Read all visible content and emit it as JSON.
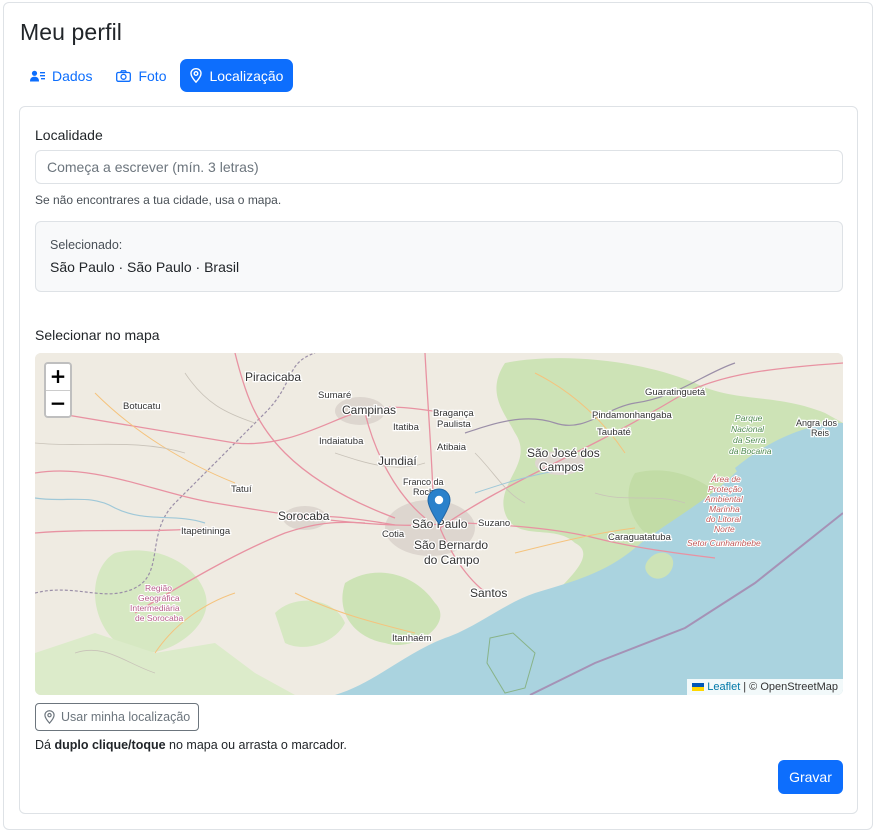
{
  "page": {
    "title": "Meu perfil"
  },
  "tabs": [
    {
      "label": "Dados",
      "icon": "user-list-icon",
      "active": false
    },
    {
      "label": "Foto",
      "icon": "camera-icon",
      "active": false
    },
    {
      "label": "Localização",
      "icon": "map-pin-icon",
      "active": true
    }
  ],
  "location": {
    "label": "Localidade",
    "placeholder": "Começa a escrever (mín. 3 letras)",
    "value": "",
    "help": "Se não encontrares a tua cidade, usa o mapa.",
    "selected_caption": "Selecionado:",
    "selected_value": "São Paulo · São Paulo · Brasil"
  },
  "map": {
    "label": "Selecionar no mapa",
    "zoom_in": "+",
    "zoom_out": "−",
    "attribution_leaflet": "Leaflet",
    "attribution_rest": "| © OpenStreetMap",
    "places": {
      "piracicaba": "Piracicaba",
      "sumare": "Sumaré",
      "campinas": "Campinas",
      "botucatu": "Botucatu",
      "braganca": "Bragança",
      "paulista": "Paulista",
      "guaratingueta": "Guaratinguetá",
      "pindamonhangaba": "Pindamonhangaba",
      "indaiatuba": "Indaiatuba",
      "itatiba": "Itatiba",
      "atibaia": "Atibaia",
      "taubate": "Taubaté",
      "sjc1": "São José dos",
      "sjc2": "Campos",
      "jundiai": "Jundiaí",
      "parque1": "Parque",
      "parque2": "Nacional",
      "parque3": "da Serra",
      "parque4": "da Bocaina",
      "angra1": "Angra dos",
      "angra2": "Reis",
      "tatui": "Tatuí",
      "franco1": "Franco da",
      "franco2": "Rocha",
      "sorocaba": "Sorocaba",
      "itapetininga": "Itapetininga",
      "sao_paulo": "São Paulo",
      "suzano": "Suzano",
      "caraguatatuba": "Caraguatatuba",
      "cotia": "Cotia",
      "sbc1": "São Bernardo",
      "sbc2": "do Campo",
      "santos": "Santos",
      "itanhaem": "Itanhaém",
      "regiao1": "Região",
      "regiao2": "Geográfica",
      "regiao3": "Intermediária",
      "regiao4": "de Sorocaba",
      "area1": "Área de",
      "area2": "Proteção",
      "area3": "Ambiental",
      "area4": "Marinha",
      "area5": "do Litoral",
      "area6": "Norte",
      "area7": "Setor Cunhambebe"
    }
  },
  "geo_button_label": "Usar minha localização",
  "hint": {
    "prefix": "Dá ",
    "bold": "duplo clique/toque",
    "suffix": " no mapa ou arrasta o marcador."
  },
  "save_label": "Gravar",
  "colors": {
    "primary": "#0d6efd",
    "sea": "#aad3df",
    "land": "#f0ede5",
    "forest": "#c8e0b0",
    "marker": "#2a81cb"
  }
}
